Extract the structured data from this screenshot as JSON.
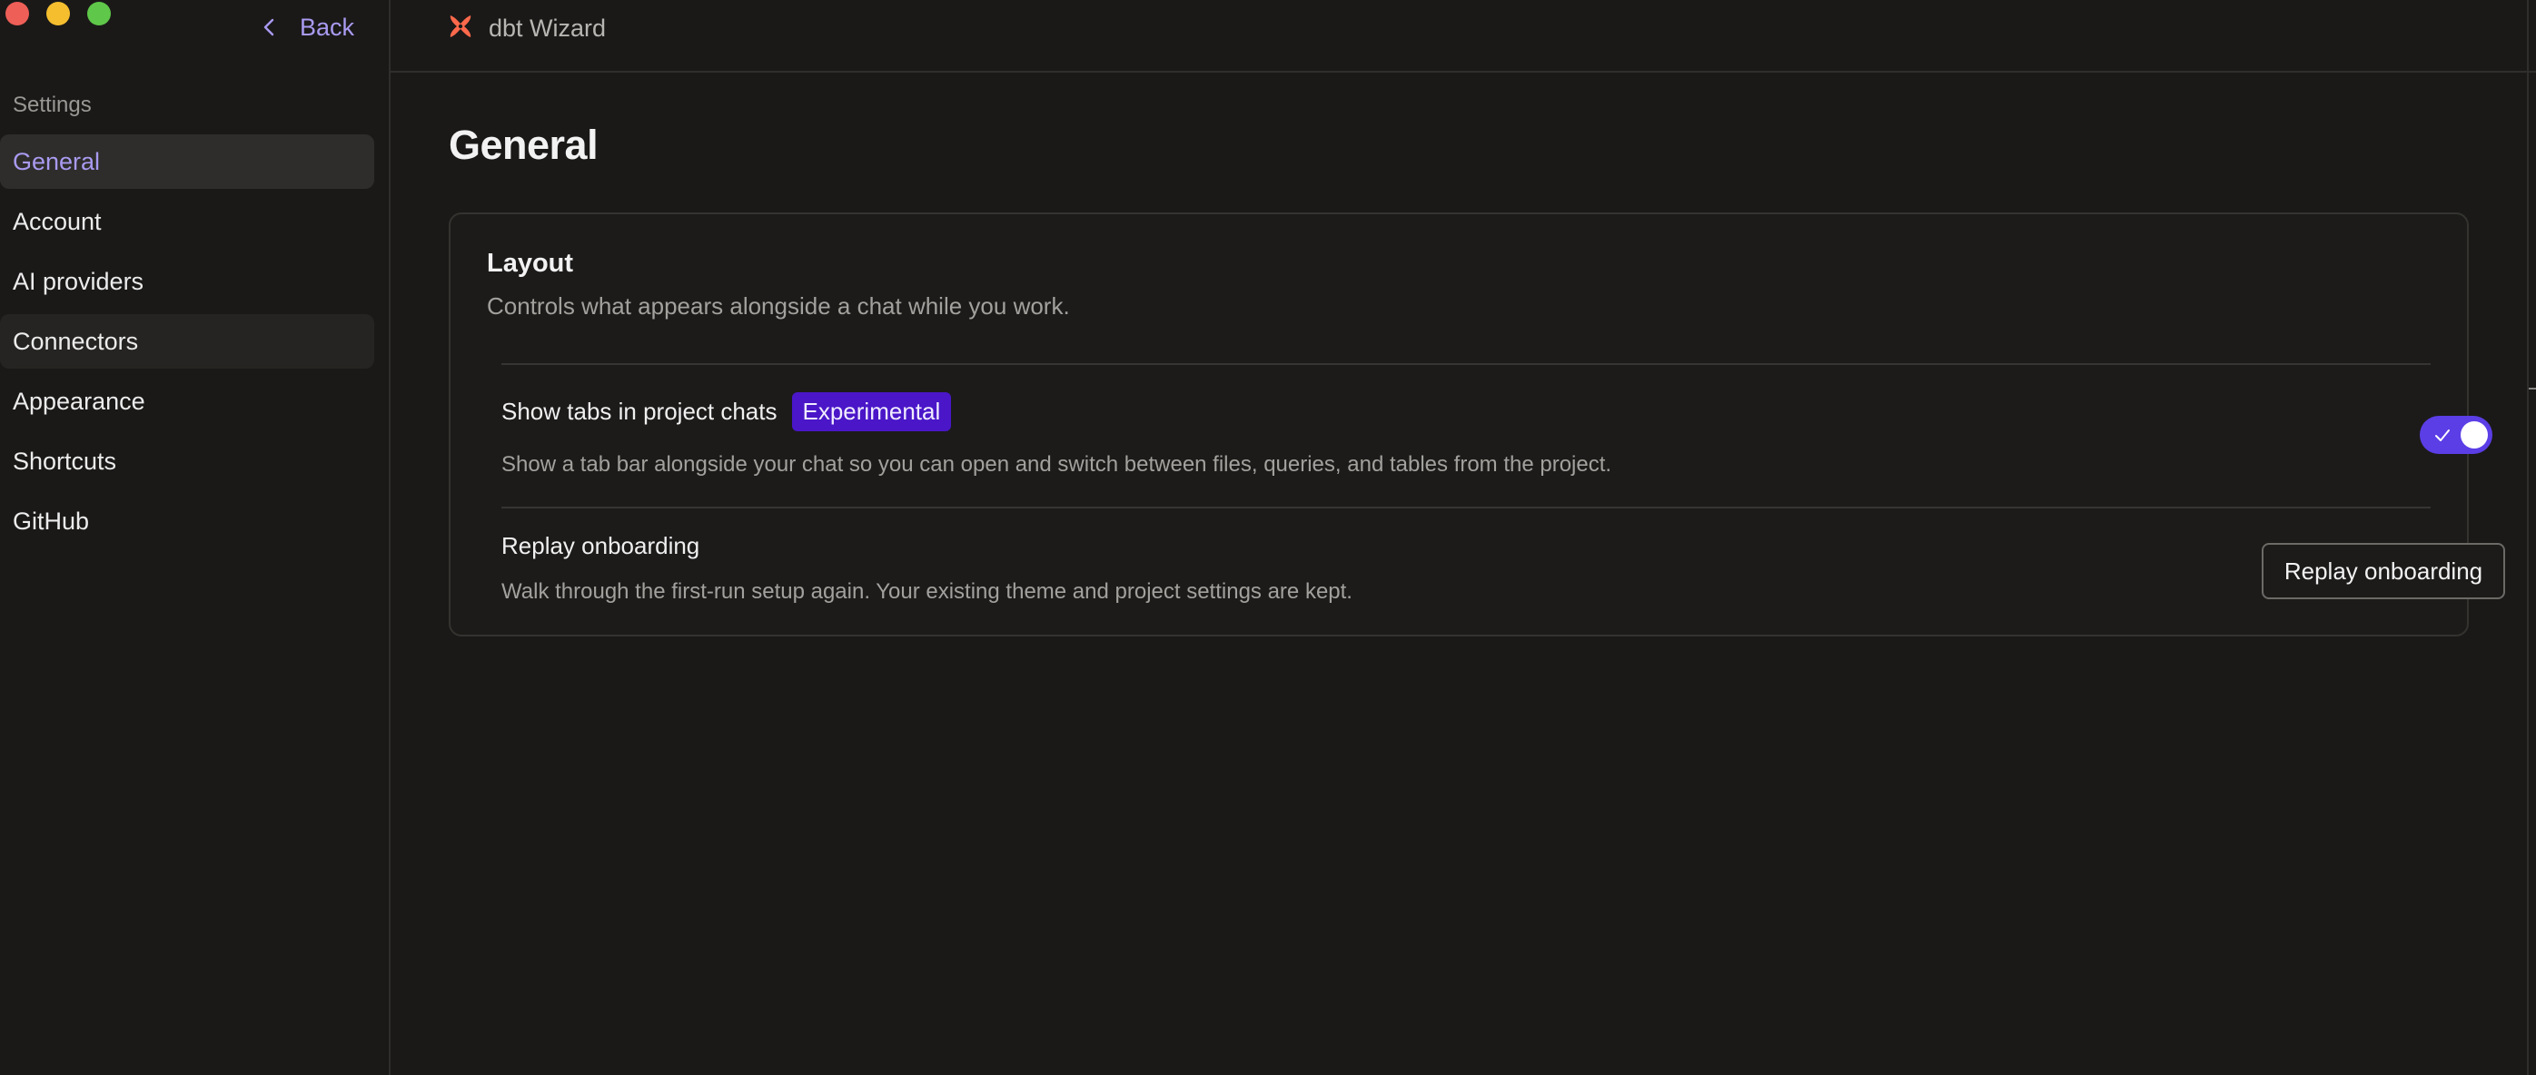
{
  "window": {
    "controls": [
      "close",
      "minimize",
      "maximize"
    ]
  },
  "header": {
    "back_label": "Back",
    "app_name": "dbt Wizard",
    "logo_icon": "dbt-logo-icon",
    "logo_color": "#ff694b"
  },
  "sidebar": {
    "heading": "Settings",
    "items": [
      {
        "label": "General",
        "active": true
      },
      {
        "label": "Account"
      },
      {
        "label": "AI providers"
      },
      {
        "label": "Connectors",
        "hovered": true
      },
      {
        "label": "Appearance"
      },
      {
        "label": "Shortcuts"
      },
      {
        "label": "GitHub"
      }
    ]
  },
  "main": {
    "title": "General",
    "section": {
      "title": "Layout",
      "description": "Controls what appears alongside a chat while you work.",
      "settings": [
        {
          "label": "Show tabs in project chats",
          "badge": "Experimental",
          "description": "Show a tab bar alongside your chat so you can open and switch between files, queries, and tables from the project.",
          "control": "toggle",
          "enabled": true
        },
        {
          "label": "Replay onboarding",
          "description": "Walk through the first-run setup again. Your existing theme and project settings are kept.",
          "control": "button",
          "button_label": "Replay onboarding"
        }
      ]
    }
  },
  "colors": {
    "accent": "#a99af0",
    "badge_bg": "#4a16c8",
    "toggle_on": "#5b3ee6",
    "background": "#1a1918"
  }
}
